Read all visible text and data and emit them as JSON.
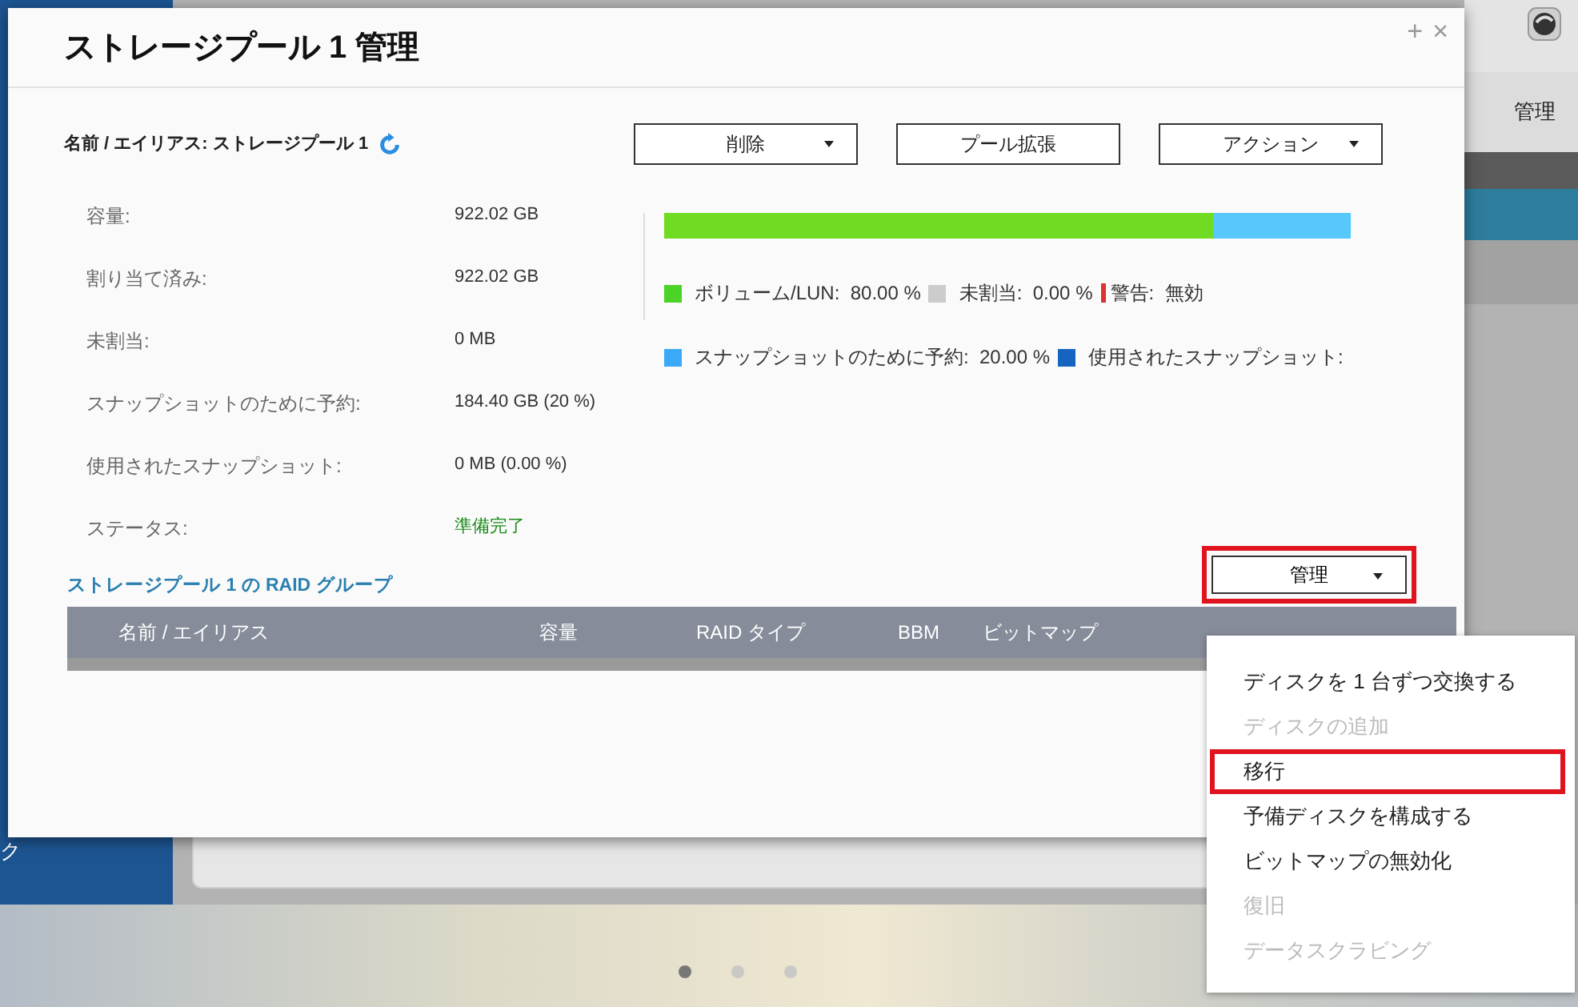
{
  "dialog": {
    "title": "ストレージプール 1 管理",
    "controls": [
      "+",
      "×"
    ],
    "name_label": "名前 / エイリアス: ストレージプール 1",
    "buttons": [
      {
        "label": "削除",
        "dropdown": true
      },
      {
        "label": "プール拡張",
        "dropdown": false
      },
      {
        "label": "アクション",
        "dropdown": true
      }
    ],
    "details": [
      {
        "label": "容量:",
        "value": "922.02 GB",
        "kind": "plain"
      },
      {
        "label": "割り当て済み:",
        "value": "922.02 GB",
        "kind": "plain"
      },
      {
        "label": "未割当:",
        "value": "0 MB",
        "kind": "plain"
      },
      {
        "label": "スナップショットのために予約:",
        "value": "184.40 GB (20 %)",
        "kind": "plain"
      },
      {
        "label": "使用されたスナップショット:",
        "value": "0 MB (0.00 %)",
        "kind": "plain"
      },
      {
        "label": "ステータス:",
        "value": "準備完了",
        "kind": "status"
      }
    ],
    "usage_bar": [
      {
        "level": 0.8,
        "color": "#6fdc23"
      },
      {
        "level": 0.2,
        "color": "#56c8fb"
      }
    ],
    "legend_rows": [
      [
        {
          "label": "ボリューム/LUN:",
          "value": "80.00 %",
          "color": "#4cd327",
          "kind": "square"
        },
        {
          "label": "未割当:",
          "value": "0.00 %",
          "color": "#cccccc",
          "kind": "square"
        },
        {
          "label": "警告:",
          "value": "無効",
          "color": "#e03030",
          "kind": "line"
        }
      ],
      [
        {
          "label": "スナップショットのために予約:",
          "value": "20.00 %",
          "color": "#3aaaf8",
          "kind": "square"
        },
        {
          "label": "使用されたスナップショット:",
          "color": "#1565c0",
          "kind": "square"
        }
      ]
    ],
    "raid_title": "ストレージプール 1 の RAID グループ",
    "manage_button": {
      "label": "管理",
      "highlighted": true
    },
    "table": {
      "columns": [
        "名前 / エイリアス",
        "容量",
        "RAID タイプ",
        "BBM",
        "ビットマップ"
      ]
    }
  },
  "menu": [
    {
      "label": "ディスクを 1 台ずつ交換する",
      "disabled": false,
      "highlighted": false
    },
    {
      "label": "ディスクの追加",
      "disabled": true,
      "highlighted": false
    },
    {
      "label": "移行",
      "disabled": false,
      "highlighted": true
    },
    {
      "label": "予備ディスクを構成する",
      "disabled": false,
      "highlighted": false
    },
    {
      "label": "ビットマップの無効化",
      "disabled": false,
      "highlighted": false
    },
    {
      "label": "復旧",
      "disabled": true,
      "highlighted": false
    },
    {
      "label": "データスクラビング",
      "disabled": true,
      "highlighted": false
    }
  ],
  "background": {
    "app_tab": "管理",
    "sidebar_text": "ク",
    "pager": [
      {
        "selected": true
      },
      {
        "selected": false
      },
      {
        "selected": false
      }
    ]
  }
}
